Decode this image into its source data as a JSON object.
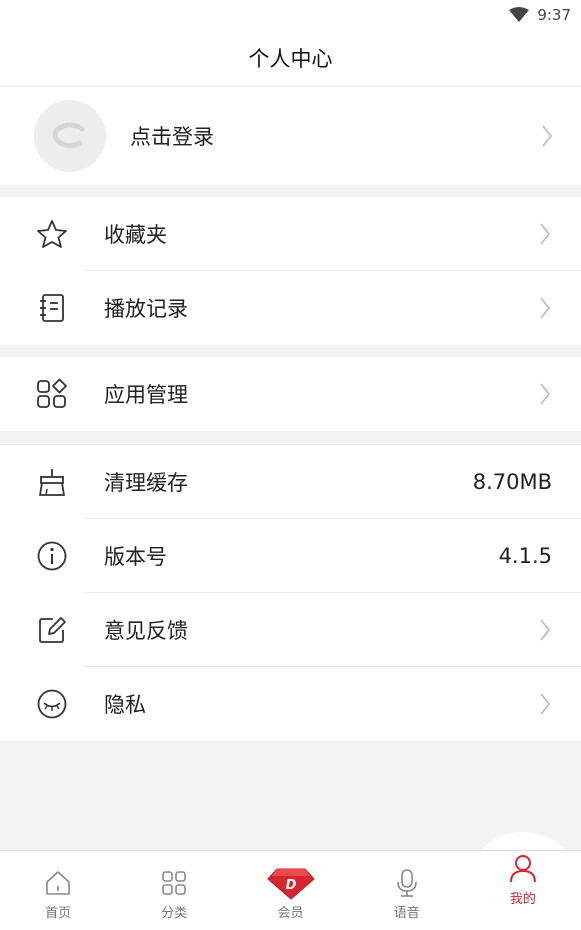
{
  "status": {
    "time": "9:37",
    "wifi_icon": "wifi-icon"
  },
  "header": {
    "title": "个人中心"
  },
  "login": {
    "label": "点击登录",
    "avatar_icon": "avatar-placeholder-icon"
  },
  "menu": {
    "group1": [
      {
        "label": "收藏夹",
        "icon": "star-icon"
      },
      {
        "label": "播放记录",
        "icon": "history-notebook-icon"
      }
    ],
    "group2": [
      {
        "label": "应用管理",
        "icon": "apps-grid-icon"
      }
    ],
    "group3": [
      {
        "label": "清理缓存",
        "icon": "broom-icon",
        "value": "8.70MB"
      },
      {
        "label": "版本号",
        "icon": "info-icon",
        "value": "4.1.5"
      },
      {
        "label": "意见反馈",
        "icon": "feedback-edit-icon"
      },
      {
        "label": "隐私",
        "icon": "privacy-eye-icon"
      }
    ]
  },
  "tabbar": {
    "tabs": [
      {
        "label": "首页",
        "icon": "home-icon"
      },
      {
        "label": "分类",
        "icon": "category-icon"
      },
      {
        "label": "会员",
        "icon": "vip-diamond-icon"
      },
      {
        "label": "语音",
        "icon": "microphone-icon"
      },
      {
        "label": "我的",
        "icon": "profile-icon",
        "active": true
      }
    ]
  },
  "colors": {
    "accent": "#d9262e",
    "background": "#f3f3f3"
  }
}
